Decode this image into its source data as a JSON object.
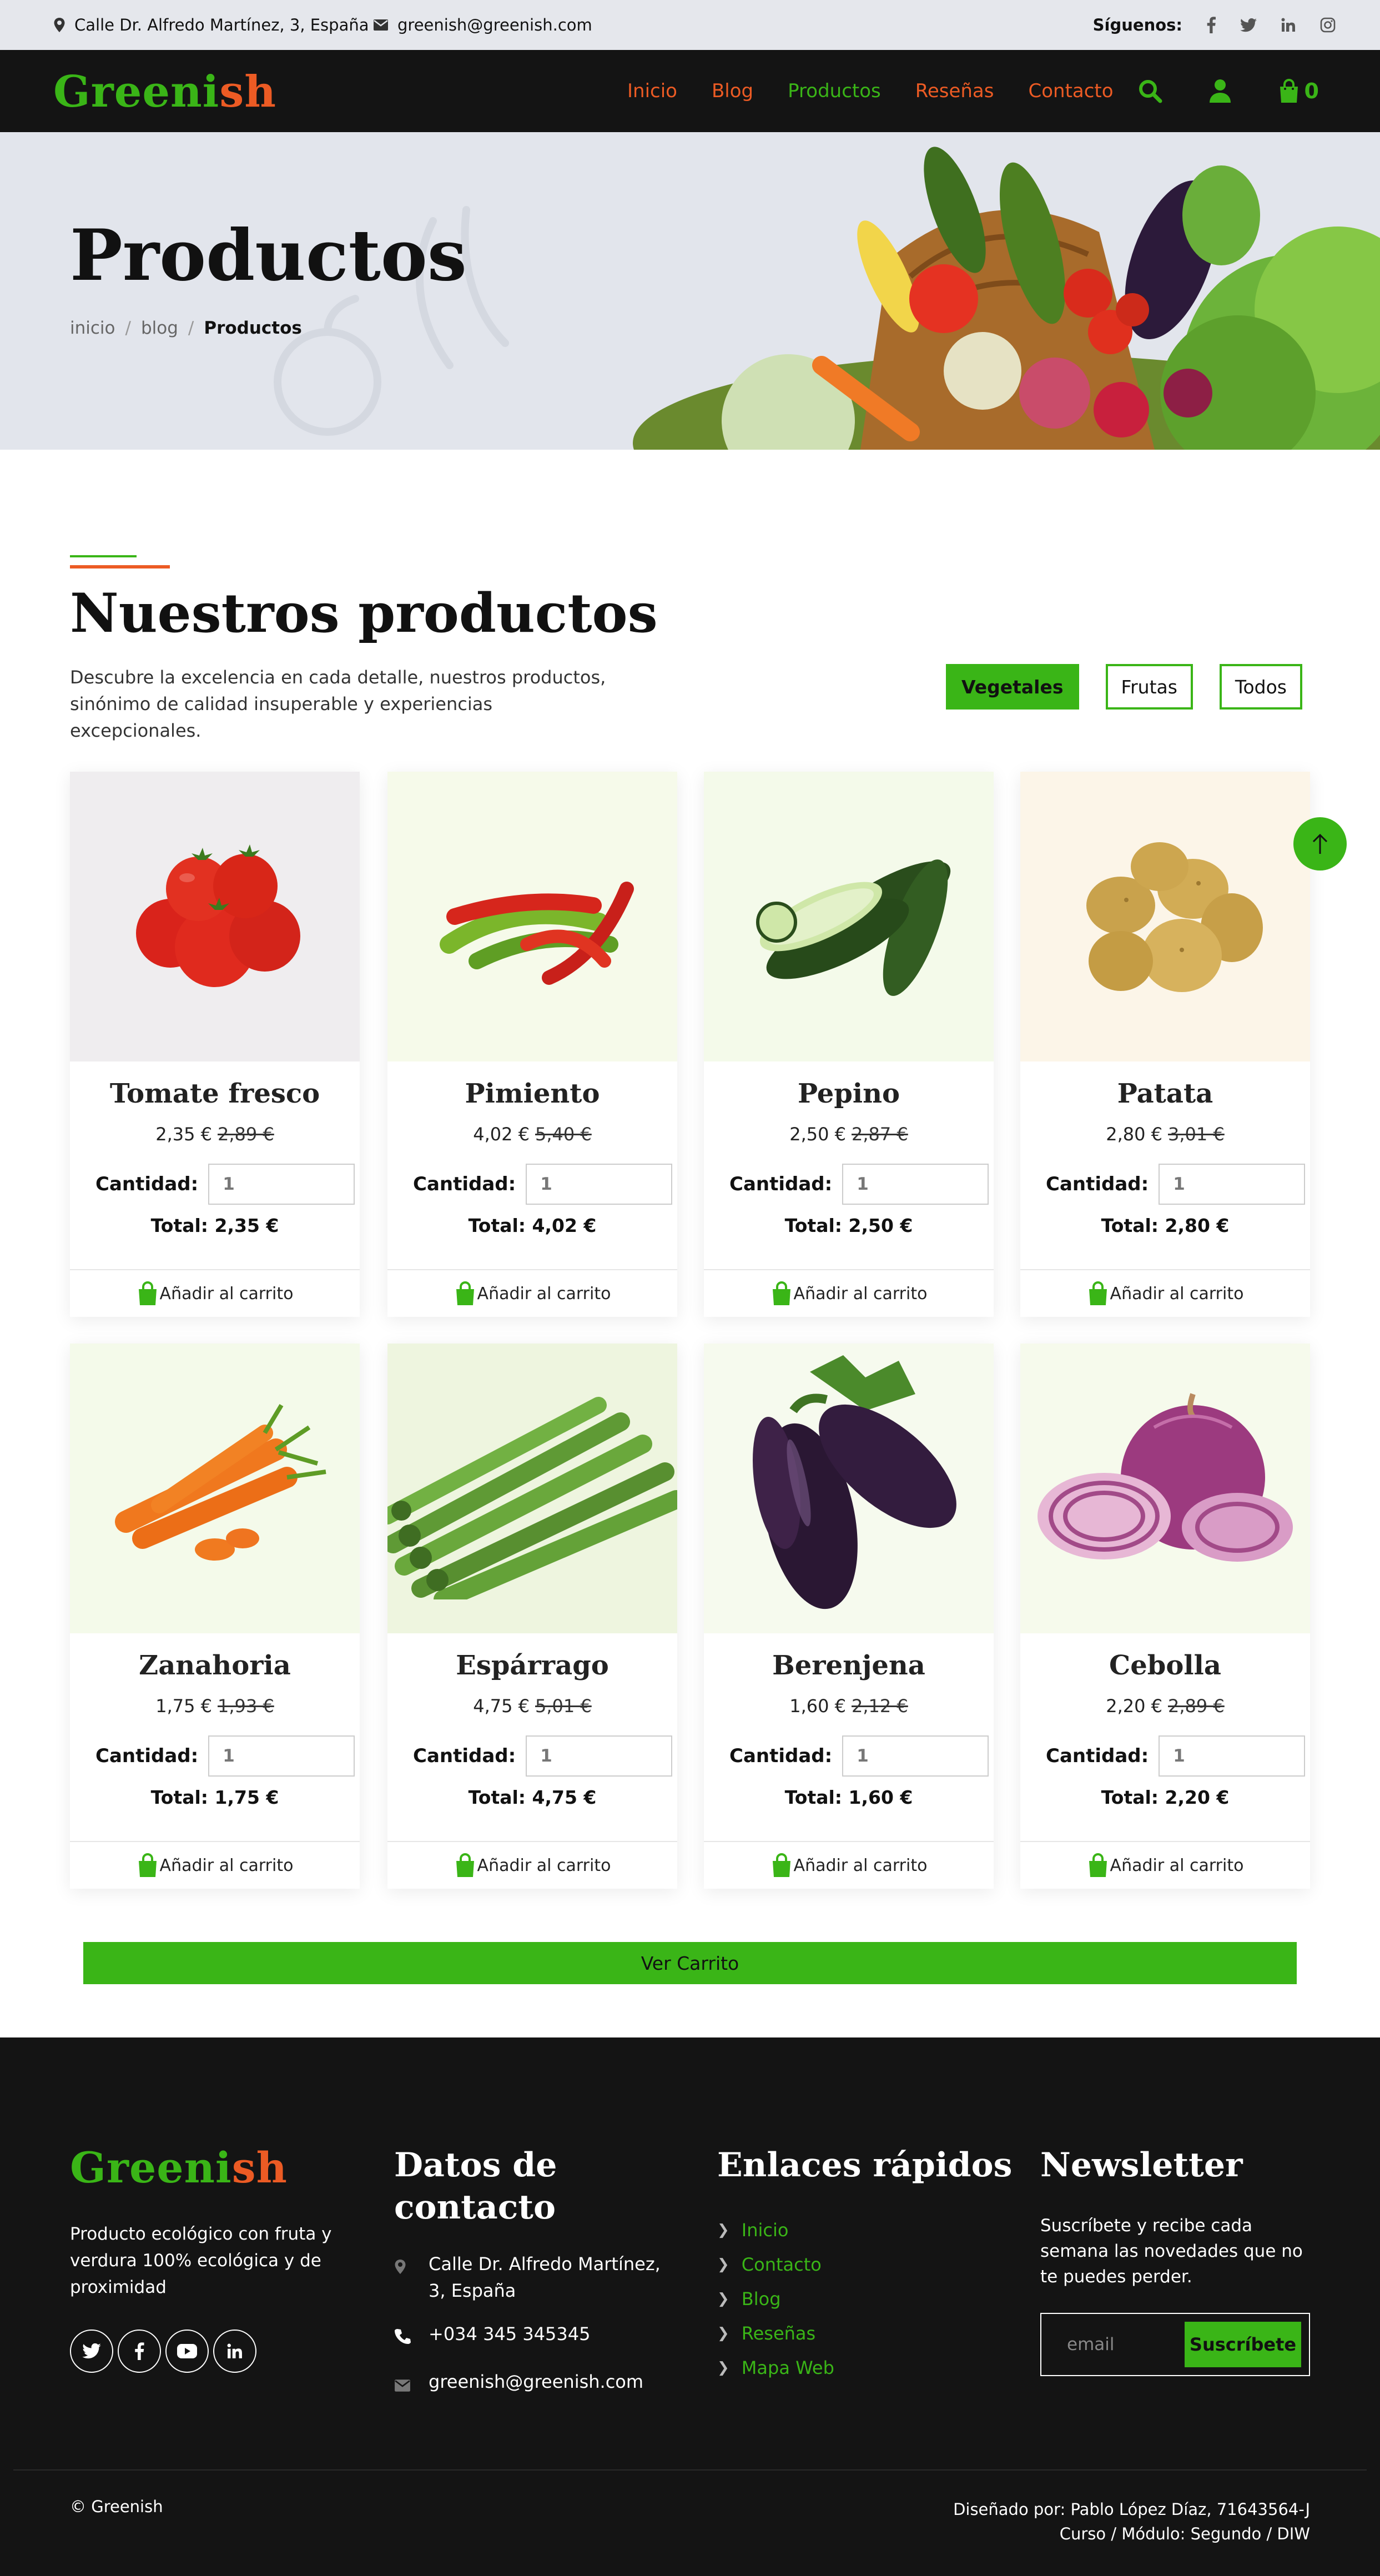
{
  "topbar": {
    "address": "Calle Dr. Alfredo Martínez, 3, España",
    "email": "greenish@greenish.com",
    "follow_label": "Síguenos:"
  },
  "brand": {
    "part1": "Greeni",
    "part2": "sh",
    "colors": {
      "green": "#3ab517",
      "orange": "#ec5b24"
    }
  },
  "nav": {
    "links": [
      "Inicio",
      "Blog",
      "Productos",
      "Reseñas",
      "Contacto"
    ],
    "active": "Productos",
    "cart_count": "0"
  },
  "hero": {
    "title": "Productos",
    "breadcrumb": [
      "inicio",
      "blog",
      "Productos"
    ]
  },
  "section": {
    "title": "Nuestros productos",
    "description": "Descubre la excelencia en cada detalle, nuestros productos, sinónimo de calidad insuperable y experiencias excepcionales.",
    "filters": [
      "Vegetales",
      "Frutas",
      "Todos"
    ],
    "active_filter": "Vegetales"
  },
  "labels": {
    "quantity": "Cantidad:",
    "add_to_cart": "Añadir al carrito",
    "view_cart": "Ver Carrito"
  },
  "products": [
    {
      "name": "Tomate fresco",
      "price": "2,35 €",
      "old_price": "2,89 €",
      "qty": "1",
      "total": "Total: 2,35 €"
    },
    {
      "name": "Pimiento",
      "price": "4,02 €",
      "old_price": "5,40 €",
      "qty": "1",
      "total": "Total: 4,02 €"
    },
    {
      "name": "Pepino",
      "price": "2,50 €",
      "old_price": "2,87 €",
      "qty": "1",
      "total": "Total: 2,50 €"
    },
    {
      "name": "Patata",
      "price": "2,80 €",
      "old_price": "3,01 €",
      "qty": "1",
      "total": "Total: 2,80 €"
    },
    {
      "name": "Zanahoria",
      "price": "1,75 €",
      "old_price": "1,93 €",
      "qty": "1",
      "total": "Total: 1,75 €"
    },
    {
      "name": "Espárrago",
      "price": "4,75 €",
      "old_price": "5,01 €",
      "qty": "1",
      "total": "Total: 4,75 €"
    },
    {
      "name": "Berenjena",
      "price": "1,60 €",
      "old_price": "2,12 €",
      "qty": "1",
      "total": "Total: 1,60 €"
    },
    {
      "name": "Cebolla",
      "price": "2,20 €",
      "old_price": "2,89 €",
      "qty": "1",
      "total": "Total: 2,20 €"
    }
  ],
  "footer": {
    "about": "Producto ecológico con fruta y verdura 100% ecológica y de proximidad",
    "contact_title": "Datos de contacto",
    "contact_address": "Calle Dr. Alfredo Martínez, 3, España",
    "contact_phone": "+034 345 345345",
    "contact_email": "greenish@greenish.com",
    "links_title": "Enlaces rápidos",
    "links": [
      "Inicio",
      "Contacto",
      "Blog",
      "Reseñas",
      "Mapa Web"
    ],
    "newsletter_title": "Newsletter",
    "newsletter_text": "Suscríbete y recibe cada semana las novedades que no te puedes perder.",
    "email_placeholder": "email",
    "subscribe": "Suscríbete",
    "copyright": "© Greenish",
    "credit_line1": "Diseñado por: Pablo López Díaz, 71643564-J",
    "credit_line2": "Curso / Módulo: Segundo / DIW"
  }
}
